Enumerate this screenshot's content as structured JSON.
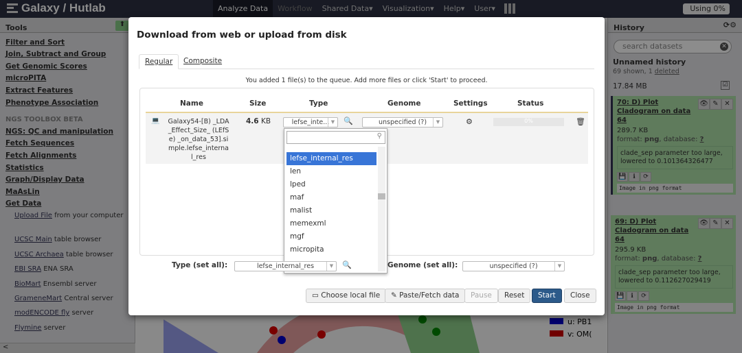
{
  "navbar": {
    "brand": "Galaxy / Hutlab",
    "menu": [
      "Analyze Data",
      "Workflow",
      "Shared Data▾",
      "Visualization▾",
      "Help▾",
      "User▾"
    ],
    "usage": "Using 0%"
  },
  "tools": {
    "title": "Tools",
    "items": [
      "Filter and Sort",
      "Join, Subtract and Group",
      "Get Genomic Scores",
      "microPITA",
      "Extract Features",
      "Phenotype Association"
    ],
    "section": "NGS TOOLBOX BETA",
    "items2": [
      "NGS: QC and manipulation",
      "Fetch Sequences",
      "Fetch Alignments",
      "Statistics",
      "Graph/Display Data",
      "MaAsLin",
      "Get Data"
    ],
    "sub": [
      {
        "link": "Upload File",
        "rest": " from your computer"
      },
      {
        "link": "UCSC Main",
        "rest": " table browser"
      },
      {
        "link": "UCSC Archaea",
        "rest": " table browser"
      },
      {
        "link": "EBI SRA",
        "rest": " ENA SRA"
      },
      {
        "link": "BioMart",
        "rest": " Ensembl server"
      },
      {
        "link": "GrameneMart",
        "rest": " Central server"
      },
      {
        "link": "modENCODE fly",
        "rest": " server"
      },
      {
        "link": "Flymine",
        "rest": " server"
      }
    ]
  },
  "history": {
    "title": "History",
    "search_placeholder": "search datasets",
    "name": "Unnamed history",
    "shown": "69 shown, 1 ",
    "deleted": "deleted",
    "size": "17.84 MB",
    "datasets": [
      {
        "title": "70: D) Plot Cladogram on data 64",
        "size": "289.7 KB",
        "format_label": "format: ",
        "format": "png",
        "db_label": ", database: ",
        "db": "?",
        "info": "clade_sep parameter too large, lowered to 0.101364326477",
        "peek": "Image in png format"
      },
      {
        "title": "69: D) Plot Cladogram on data 64",
        "size": "295.9 KB",
        "format_label": "format: ",
        "format": "png",
        "db_label": ", database: ",
        "db": "?",
        "info": "clade_sep parameter too large, lowered to 0.112627029419",
        "peek": "Image in png format"
      }
    ]
  },
  "background": {
    "legend": [
      "u: PB1",
      "v: OM("
    ]
  },
  "modal": {
    "title": "Download from web or upload from disk",
    "tabs": [
      "Regular",
      "Composite"
    ],
    "message": "You added 1 file(s) to the queue. Add more files or click 'Start' to proceed.",
    "columns": [
      "Name",
      "Size",
      "Type",
      "Genome",
      "Settings",
      "Status"
    ],
    "file": {
      "name": "Galaxy54-[B) _LDA_Effect_Size_ (LEfSe) _on_data_53].simple.lefse_internal_res",
      "size_num": "4.6",
      "size_unit": " KB",
      "type": "lefse_inte...",
      "genome": "unspecified (?)",
      "status": "0%",
      "progress": 0
    },
    "dropdown": {
      "search_value": "",
      "items": [
        "lefse_internal_res",
        "len",
        "lped",
        "maf",
        "malist",
        "memexml",
        "mgf",
        "micropita"
      ],
      "selected": "lefse_internal_res"
    },
    "type_all_label": "Type (set all):",
    "type_all": "lefse_internal_res",
    "genome_all_label": "Genome (set all):",
    "genome_all": "unspecified (?)",
    "buttons": {
      "choose": "Choose local file",
      "paste": "Paste/Fetch data",
      "pause": "Pause",
      "reset": "Reset",
      "start": "Start",
      "close": "Close"
    },
    "colors": {
      "primary": "#2c5a8a",
      "highlight": "#3875d7"
    }
  }
}
